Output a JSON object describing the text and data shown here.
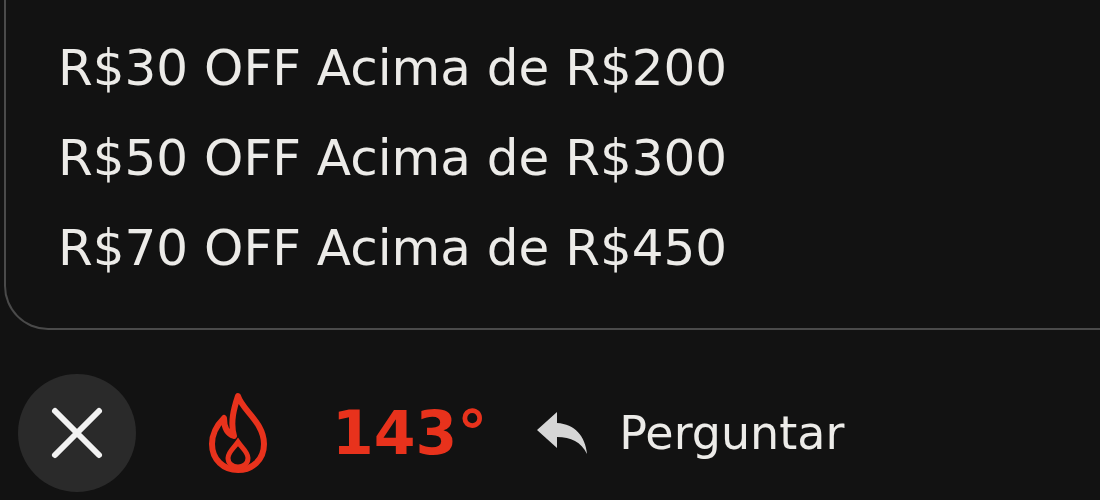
{
  "offers": [
    "R$30 OFF Acima de R$200",
    "R$50 OFF Acima de R$300",
    "R$70 OFF Acima de R$450"
  ],
  "footer": {
    "temperature": "143°",
    "reply_label": "Perguntar"
  }
}
